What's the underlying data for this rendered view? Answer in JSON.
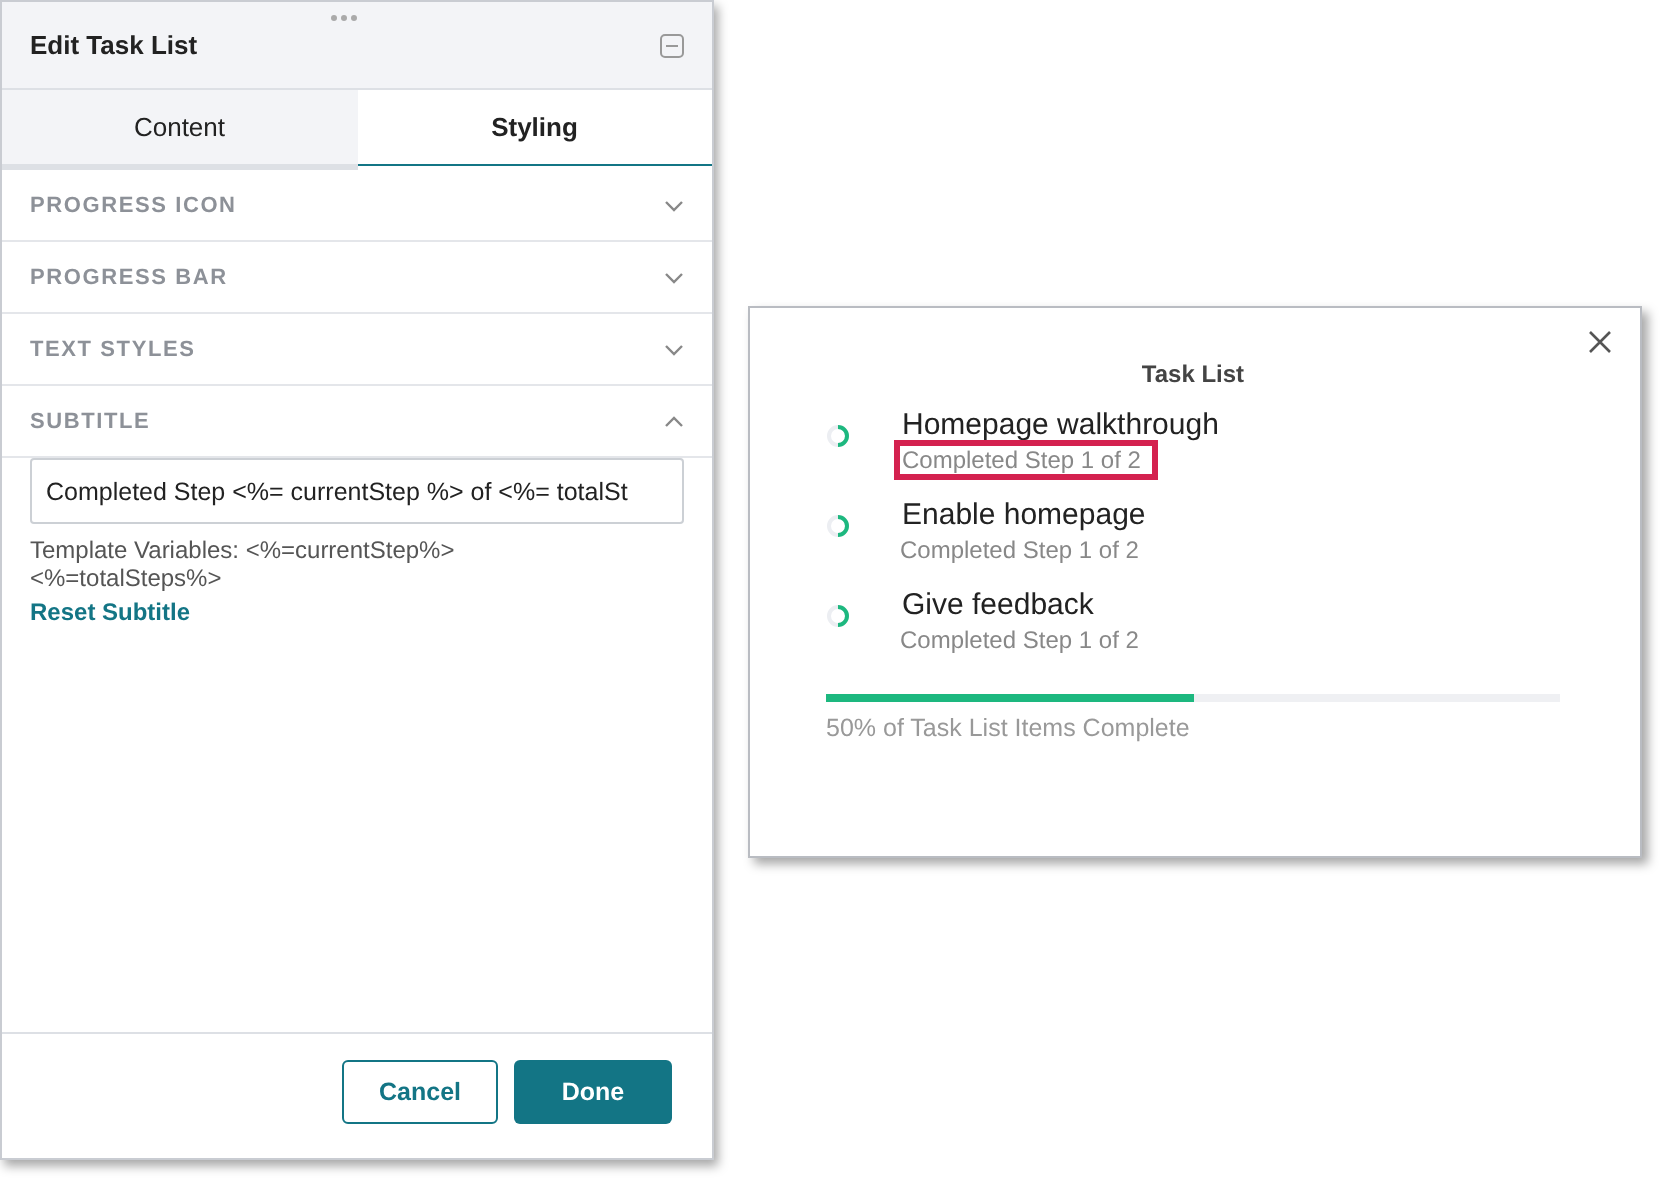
{
  "editor": {
    "title": "Edit Task List",
    "tabs": [
      {
        "label": "Content",
        "selected": false
      },
      {
        "label": "Styling",
        "selected": true
      }
    ],
    "sections": [
      {
        "label": "PROGRESS ICON",
        "expanded": false
      },
      {
        "label": "PROGRESS BAR",
        "expanded": false
      },
      {
        "label": "TEXT STYLES",
        "expanded": false
      },
      {
        "label": "SUBTITLE",
        "expanded": true
      }
    ],
    "subtitle_field": {
      "value": "Completed Step <%= currentStep %> of <%= totalSt"
    },
    "hint": "Template Variables: <%=currentStep%> <%=totalSteps%>",
    "reset_link": "Reset Subtitle",
    "buttons": [
      {
        "label": "Cancel",
        "kind": "secondary"
      },
      {
        "label": "Done",
        "kind": "primary"
      }
    ]
  },
  "task_list": {
    "title": "Task List",
    "items": [
      {
        "title": "Homepage walkthrough",
        "subtitle": "Completed Step 1 of 2",
        "highlighted": true
      },
      {
        "title": "Enable homepage",
        "subtitle": "Completed Step 1 of 2",
        "highlighted": false
      },
      {
        "title": "Give feedback",
        "subtitle": "Completed Step 1 of 2",
        "highlighted": false
      }
    ],
    "progress": {
      "level": 0.5
    },
    "progress_text": "50% of Task List Items Complete"
  }
}
